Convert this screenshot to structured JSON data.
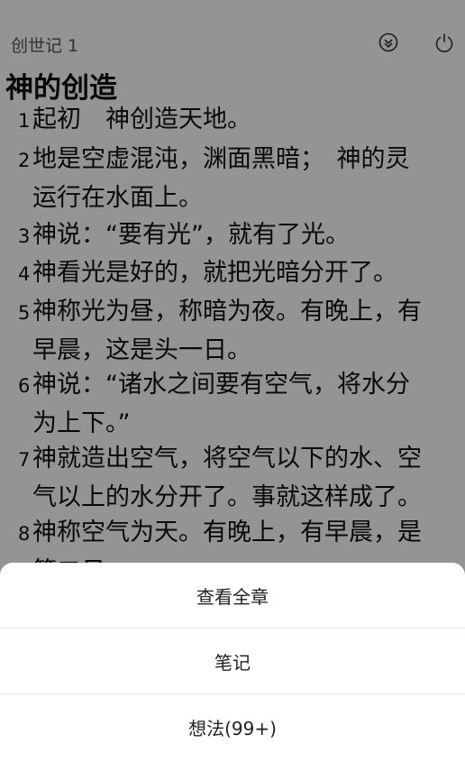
{
  "header": {
    "chapter_ref": "创世记 1",
    "icons": [
      "collapse-circle-icon",
      "power-icon"
    ]
  },
  "section_title": "神的创造",
  "verses": [
    {
      "num": "1",
      "lines": [
        "起初　神创造天地。"
      ]
    },
    {
      "num": "2",
      "lines": [
        "地是空虚混沌，渊面黑暗；　神的灵",
        "运行在水面上。"
      ]
    },
    {
      "num": "3",
      "lines": [
        "神说：“要有光”，就有了光。"
      ]
    },
    {
      "num": "4",
      "lines": [
        "神看光是好的，就把光暗分开了。"
      ]
    },
    {
      "num": "5",
      "lines": [
        "神称光为昼，称暗为夜。有晚上，有",
        "早晨，这是头一日。"
      ]
    },
    {
      "num": "6",
      "lines": [
        "神说：“诸水之间要有空气，将水分",
        "为上下。”"
      ]
    },
    {
      "num": "7",
      "lines": [
        "神就造出空气，将空气以下的水、空",
        "气以上的水分开了。事就这样成了。"
      ]
    },
    {
      "num": "8",
      "lines": [
        "神称空气为天。有晚上，有早晨，是",
        "第二日。"
      ]
    }
  ],
  "sheet": {
    "view_chapter": "查看全章",
    "notes": "笔记",
    "thoughts": "想法(99+)"
  },
  "colors": {
    "overlay": "#000000",
    "sheet_bg": "#ffffff"
  }
}
